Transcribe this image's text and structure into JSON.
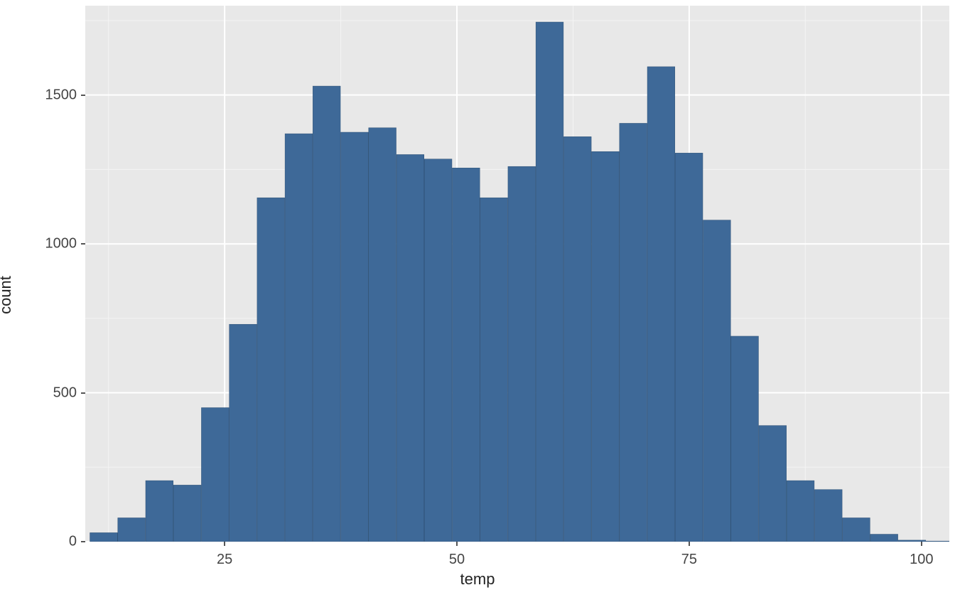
{
  "chart_data": {
    "type": "bar",
    "xlabel": "temp",
    "ylabel": "count",
    "xlim": [
      10,
      103
    ],
    "ylim": [
      0,
      1800
    ],
    "x_ticks": [
      25,
      50,
      75,
      100
    ],
    "y_ticks": [
      0,
      500,
      1000,
      1500
    ],
    "bin_width": 3,
    "bin_centers": [
      12,
      15,
      18,
      21,
      24,
      27,
      30,
      33,
      36,
      39,
      42,
      45,
      48,
      51,
      54,
      57,
      60,
      63,
      66,
      69,
      72,
      75,
      78,
      81,
      84,
      87,
      90,
      93,
      96,
      99,
      102
    ],
    "values": [
      30,
      80,
      205,
      190,
      450,
      730,
      1155,
      1370,
      1530,
      1375,
      1390,
      1300,
      1285,
      1255,
      1155,
      1260,
      1745,
      1360,
      1310,
      1405,
      1595,
      1305,
      1080,
      690,
      390,
      205,
      175,
      80,
      25,
      5,
      2
    ],
    "bar_fill": "#3e6998",
    "bar_stroke": "#2f5175",
    "panel_bg": "#e8e8e8",
    "grid_major": "#ffffff"
  }
}
